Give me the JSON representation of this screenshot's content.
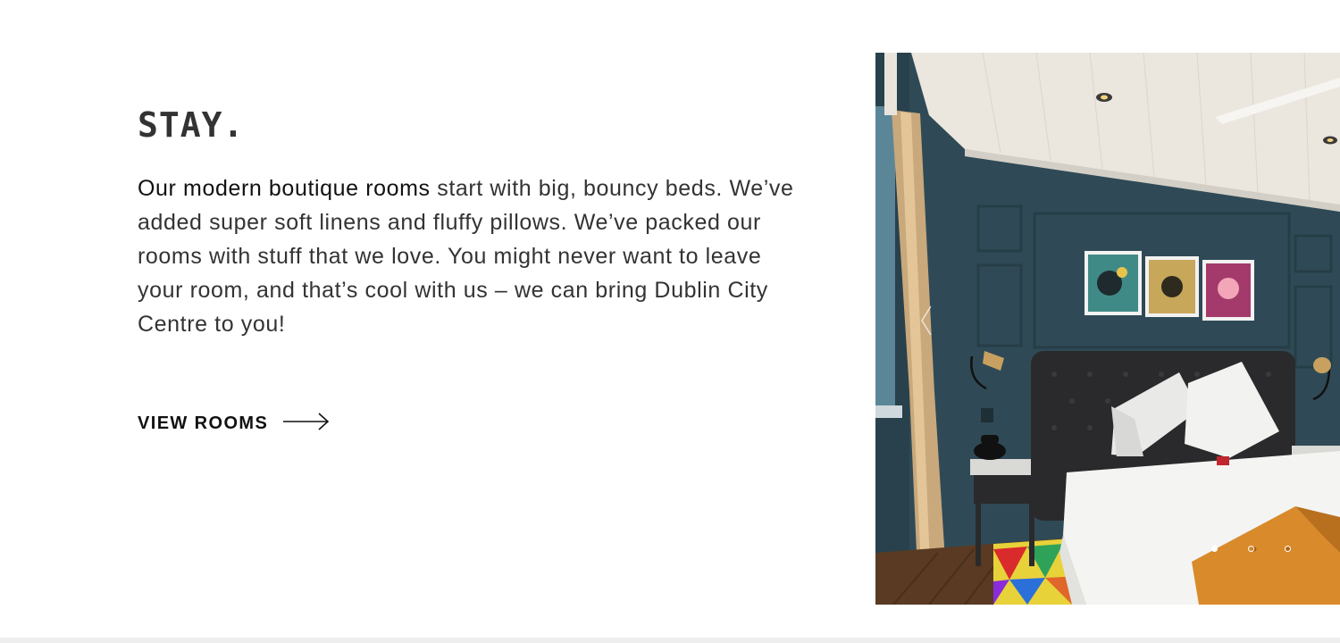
{
  "section": {
    "heading": "STAY.",
    "body_link": "Our modern boutique rooms",
    "body_rest": " start with big, bouncy beds. We’ve added super soft linens and fluffy pillows. We’ve packed our rooms with stuff that we love. You might never want to leave your room, and that’s cool with us – we can bring Dublin City Centre to you!",
    "cta_label": "VIEW ROOMS"
  },
  "carousel": {
    "slide_count": 3,
    "active_index": 0
  },
  "colors": {
    "text": "#333333",
    "wall": "#2f4a56",
    "ceiling": "#ebe6de",
    "headboard": "#2a2a2c",
    "throw": "#d98a2b",
    "curtain": "#c9a87c"
  }
}
